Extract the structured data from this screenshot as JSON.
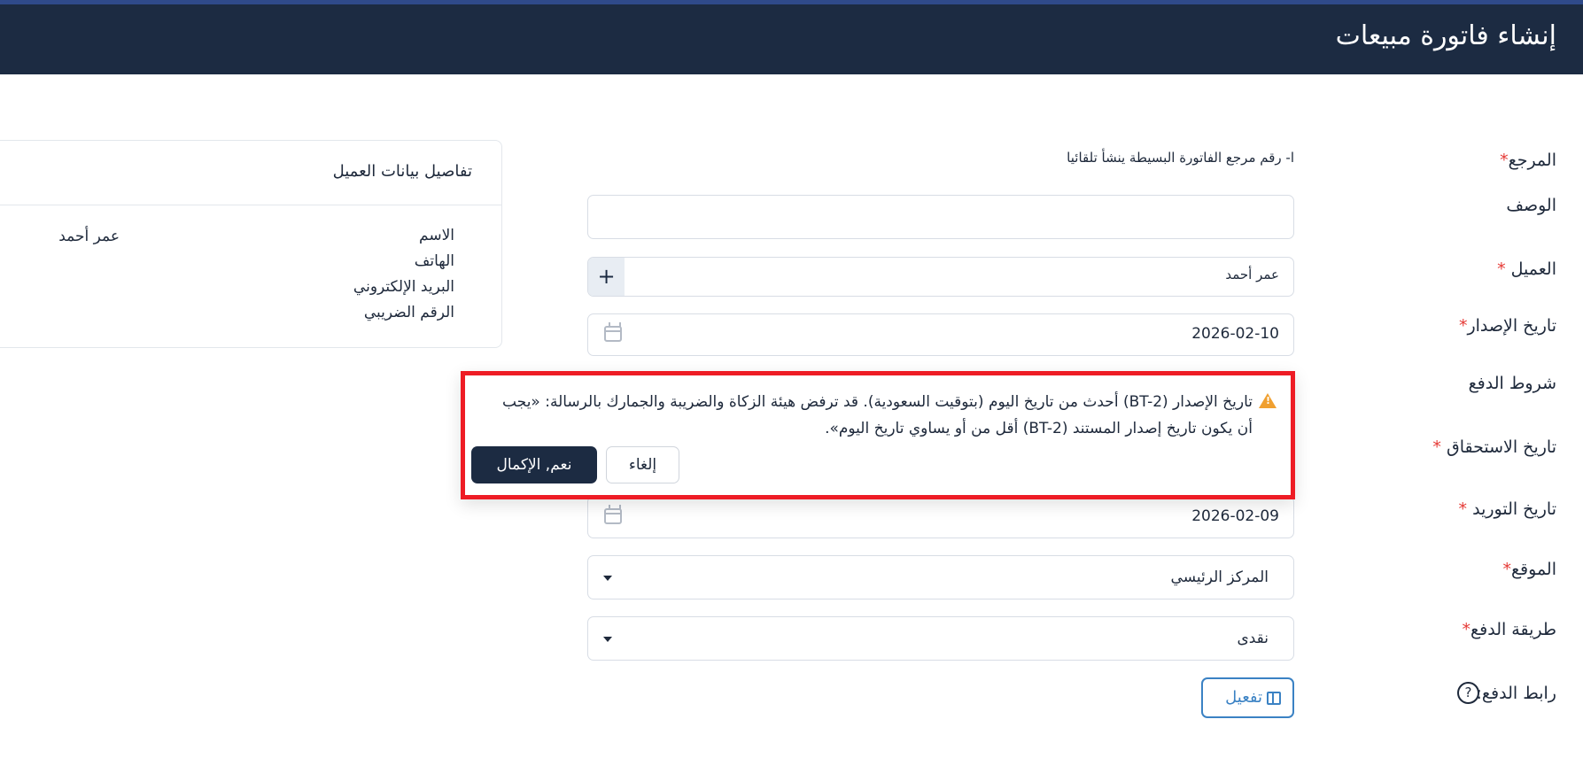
{
  "header": {
    "title": "إنشاء فاتورة مبيعات"
  },
  "form": {
    "reference": {
      "label": "المرجع",
      "required_mark": "*",
      "note": "ا- رقم مرجع الفاتورة البسيطة ينشأ تلقائيا"
    },
    "description": {
      "label": "الوصف",
      "value": ""
    },
    "customer": {
      "label": "العميل",
      "required_mark": "*",
      "value": "عمر أحمد",
      "add_button": "+"
    },
    "issue_date": {
      "label": "تاريخ الإصدار",
      "required_mark": "*",
      "value": "2026-02-10"
    },
    "payment_terms": {
      "label": "شروط الدفع"
    },
    "due_date": {
      "label": "تاريخ الاستحقاق",
      "required_mark": "*"
    },
    "supply_date": {
      "label": "تاريخ التوريد",
      "required_mark": "*",
      "value": "2026-02-09"
    },
    "location": {
      "label": "الموقع",
      "required_mark": "*",
      "value": "المركز الرئيسي"
    },
    "payment_method": {
      "label": "طريقة الدفع",
      "required_mark": "*",
      "value": "نقدى"
    },
    "payment_link": {
      "label": "رابط الدفع:",
      "button": "تفعيل",
      "help": "?"
    }
  },
  "customer_card": {
    "title": "تفاصيل بيانات العميل",
    "rows": [
      "الاسم",
      "الهاتف",
      "البريد الإلكتروني",
      "الرقم الضريبي"
    ],
    "name_value": "عمر أحمد"
  },
  "warning_popover": {
    "message": "تاريخ الإصدار (BT-2) أحدث من تاريخ اليوم (بتوقيت السعودية). قد ترفض هيئة الزكاة والضريبة والجمارك بالرسالة: «يجب أن يكون تاريخ إصدار المستند (BT-2) أقل من أو يساوي تاريخ اليوم».",
    "cancel_label": "إلغاء",
    "confirm_label": "نعم, الإكمال"
  },
  "colors": {
    "header_bg": "#1c2b42",
    "accent": "#3b82c4",
    "required": "#e53935",
    "warning": "#f0a030",
    "highlight_border": "#ee1c25"
  }
}
